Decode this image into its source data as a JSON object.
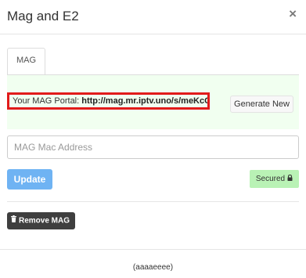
{
  "modal": {
    "title": "Mag and E2",
    "close_glyph": "×"
  },
  "tabs": [
    {
      "label": "MAG",
      "active": true
    }
  ],
  "portal": {
    "label": "Your MAG Portal:",
    "url": "http://mag.mr.iptv.uno/s/meKcCt",
    "generate_label": "Generate New"
  },
  "mac_input": {
    "placeholder": "MAG Mac Address",
    "value": ""
  },
  "update_label": "Update",
  "secured": {
    "label": "Secured",
    "icon": "lock-icon"
  },
  "remove_label": "Remove MAG",
  "footer": {
    "text": "(aaaaeeee)"
  },
  "colors": {
    "panel_bg": "#f1fff0",
    "highlight_border": "#e11b1b",
    "update_button": "#6fb3f3",
    "secured_badge": "#b9f2b5",
    "remove_button": "#3f3f3f"
  }
}
